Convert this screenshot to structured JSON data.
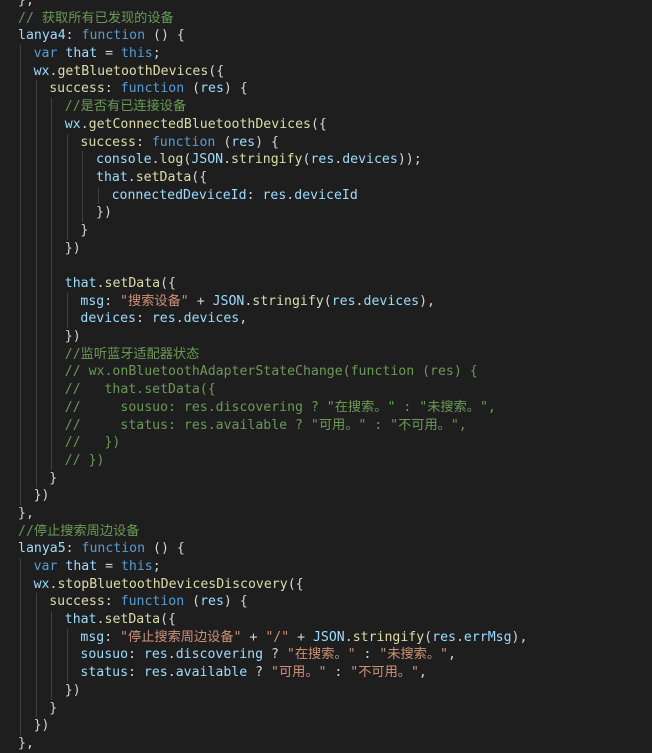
{
  "editor": {
    "lines": [
      {
        "indent": 0,
        "tokens": [
          {
            "t": "pn",
            "v": "},"
          }
        ]
      },
      {
        "indent": 0,
        "tokens": [
          {
            "t": "cm",
            "v": "// 获取所有已发现的设备"
          }
        ]
      },
      {
        "indent": 0,
        "tokens": [
          {
            "t": "var",
            "v": "lanya4"
          },
          {
            "t": "pn",
            "v": ": "
          },
          {
            "t": "kw",
            "v": "function"
          },
          {
            "t": "pn",
            "v": " () {"
          }
        ]
      },
      {
        "indent": 1,
        "tokens": [
          {
            "t": "kw",
            "v": "var"
          },
          {
            "t": "pn",
            "v": " "
          },
          {
            "t": "var",
            "v": "that"
          },
          {
            "t": "pn",
            "v": " = "
          },
          {
            "t": "kw",
            "v": "this"
          },
          {
            "t": "pn",
            "v": ";"
          }
        ]
      },
      {
        "indent": 1,
        "tokens": [
          {
            "t": "var",
            "v": "wx"
          },
          {
            "t": "pn",
            "v": "."
          },
          {
            "t": "fn",
            "v": "getBluetoothDevices"
          },
          {
            "t": "pn",
            "v": "({"
          }
        ]
      },
      {
        "indent": 2,
        "tokens": [
          {
            "t": "fn",
            "v": "success"
          },
          {
            "t": "pn",
            "v": ": "
          },
          {
            "t": "kw",
            "v": "function"
          },
          {
            "t": "pn",
            "v": " ("
          },
          {
            "t": "var",
            "v": "res"
          },
          {
            "t": "pn",
            "v": ") {"
          }
        ]
      },
      {
        "indent": 3,
        "tokens": [
          {
            "t": "cm",
            "v": "//是否有已连接设备"
          }
        ]
      },
      {
        "indent": 3,
        "tokens": [
          {
            "t": "var",
            "v": "wx"
          },
          {
            "t": "pn",
            "v": "."
          },
          {
            "t": "fn",
            "v": "getConnectedBluetoothDevices"
          },
          {
            "t": "pn",
            "v": "({"
          }
        ]
      },
      {
        "indent": 4,
        "tokens": [
          {
            "t": "fn",
            "v": "success"
          },
          {
            "t": "pn",
            "v": ": "
          },
          {
            "t": "kw",
            "v": "function"
          },
          {
            "t": "pn",
            "v": " ("
          },
          {
            "t": "var",
            "v": "res"
          },
          {
            "t": "pn",
            "v": ") {"
          }
        ]
      },
      {
        "indent": 5,
        "tokens": [
          {
            "t": "var",
            "v": "console"
          },
          {
            "t": "pn",
            "v": "."
          },
          {
            "t": "fn",
            "v": "log"
          },
          {
            "t": "pn",
            "v": "("
          },
          {
            "t": "var",
            "v": "JSON"
          },
          {
            "t": "pn",
            "v": "."
          },
          {
            "t": "fn",
            "v": "stringify"
          },
          {
            "t": "pn",
            "v": "("
          },
          {
            "t": "var",
            "v": "res"
          },
          {
            "t": "pn",
            "v": "."
          },
          {
            "t": "var",
            "v": "devices"
          },
          {
            "t": "pn",
            "v": "));"
          }
        ]
      },
      {
        "indent": 5,
        "tokens": [
          {
            "t": "var",
            "v": "that"
          },
          {
            "t": "pn",
            "v": "."
          },
          {
            "t": "fn",
            "v": "setData"
          },
          {
            "t": "pn",
            "v": "({"
          }
        ]
      },
      {
        "indent": 6,
        "tokens": [
          {
            "t": "var",
            "v": "connectedDeviceId"
          },
          {
            "t": "pn",
            "v": ": "
          },
          {
            "t": "var",
            "v": "res"
          },
          {
            "t": "pn",
            "v": "."
          },
          {
            "t": "var",
            "v": "deviceId"
          }
        ]
      },
      {
        "indent": 5,
        "tokens": [
          {
            "t": "pn",
            "v": "})"
          }
        ]
      },
      {
        "indent": 4,
        "tokens": [
          {
            "t": "pn",
            "v": "}"
          }
        ]
      },
      {
        "indent": 3,
        "tokens": [
          {
            "t": "pn",
            "v": "})"
          }
        ]
      },
      {
        "indent": 3,
        "tokens": []
      },
      {
        "indent": 3,
        "tokens": [
          {
            "t": "var",
            "v": "that"
          },
          {
            "t": "pn",
            "v": "."
          },
          {
            "t": "fn",
            "v": "setData"
          },
          {
            "t": "pn",
            "v": "({"
          }
        ]
      },
      {
        "indent": 4,
        "tokens": [
          {
            "t": "var",
            "v": "msg"
          },
          {
            "t": "pn",
            "v": ": "
          },
          {
            "t": "str",
            "v": "\"搜索设备\""
          },
          {
            "t": "pn",
            "v": " + "
          },
          {
            "t": "var",
            "v": "JSON"
          },
          {
            "t": "pn",
            "v": "."
          },
          {
            "t": "fn",
            "v": "stringify"
          },
          {
            "t": "pn",
            "v": "("
          },
          {
            "t": "var",
            "v": "res"
          },
          {
            "t": "pn",
            "v": "."
          },
          {
            "t": "var",
            "v": "devices"
          },
          {
            "t": "pn",
            "v": "),"
          }
        ]
      },
      {
        "indent": 4,
        "tokens": [
          {
            "t": "var",
            "v": "devices"
          },
          {
            "t": "pn",
            "v": ": "
          },
          {
            "t": "var",
            "v": "res"
          },
          {
            "t": "pn",
            "v": "."
          },
          {
            "t": "var",
            "v": "devices"
          },
          {
            "t": "pn",
            "v": ","
          }
        ]
      },
      {
        "indent": 3,
        "tokens": [
          {
            "t": "pn",
            "v": "})"
          }
        ]
      },
      {
        "indent": 3,
        "tokens": [
          {
            "t": "cm",
            "v": "//监听蓝牙适配器状态"
          }
        ]
      },
      {
        "indent": 3,
        "tokens": [
          {
            "t": "cm",
            "v": "// wx.onBluetoothAdapterStateChange(function (res) {"
          }
        ]
      },
      {
        "indent": 3,
        "tokens": [
          {
            "t": "cm",
            "v": "//   that.setData({"
          }
        ]
      },
      {
        "indent": 3,
        "tokens": [
          {
            "t": "cm",
            "v": "//     sousuo: res.discovering ? \"在搜索。\" : \"未搜索。\","
          }
        ]
      },
      {
        "indent": 3,
        "tokens": [
          {
            "t": "cm",
            "v": "//     status: res.available ? \"可用。\" : \"不可用。\","
          }
        ]
      },
      {
        "indent": 3,
        "tokens": [
          {
            "t": "cm",
            "v": "//   })"
          }
        ]
      },
      {
        "indent": 3,
        "tokens": [
          {
            "t": "cm",
            "v": "// })"
          }
        ]
      },
      {
        "indent": 2,
        "tokens": [
          {
            "t": "pn",
            "v": "}"
          }
        ]
      },
      {
        "indent": 1,
        "tokens": [
          {
            "t": "pn",
            "v": "})"
          }
        ]
      },
      {
        "indent": 0,
        "tokens": [
          {
            "t": "pn",
            "v": "},"
          }
        ]
      },
      {
        "indent": 0,
        "tokens": [
          {
            "t": "cm",
            "v": "//停止搜索周边设备"
          }
        ]
      },
      {
        "indent": 0,
        "tokens": [
          {
            "t": "var",
            "v": "lanya5"
          },
          {
            "t": "pn",
            "v": ": "
          },
          {
            "t": "kw",
            "v": "function"
          },
          {
            "t": "pn",
            "v": " () {"
          }
        ]
      },
      {
        "indent": 1,
        "tokens": [
          {
            "t": "kw",
            "v": "var"
          },
          {
            "t": "pn",
            "v": " "
          },
          {
            "t": "var",
            "v": "that"
          },
          {
            "t": "pn",
            "v": " = "
          },
          {
            "t": "kw",
            "v": "this"
          },
          {
            "t": "pn",
            "v": ";"
          }
        ]
      },
      {
        "indent": 1,
        "tokens": [
          {
            "t": "var",
            "v": "wx"
          },
          {
            "t": "pn",
            "v": "."
          },
          {
            "t": "fn",
            "v": "stopBluetoothDevicesDiscovery"
          },
          {
            "t": "pn",
            "v": "({"
          }
        ]
      },
      {
        "indent": 2,
        "tokens": [
          {
            "t": "fn",
            "v": "success"
          },
          {
            "t": "pn",
            "v": ": "
          },
          {
            "t": "kw",
            "v": "function"
          },
          {
            "t": "pn",
            "v": " ("
          },
          {
            "t": "var",
            "v": "res"
          },
          {
            "t": "pn",
            "v": ") {"
          }
        ]
      },
      {
        "indent": 3,
        "tokens": [
          {
            "t": "var",
            "v": "that"
          },
          {
            "t": "pn",
            "v": "."
          },
          {
            "t": "fn",
            "v": "setData"
          },
          {
            "t": "pn",
            "v": "({"
          }
        ]
      },
      {
        "indent": 4,
        "tokens": [
          {
            "t": "var",
            "v": "msg"
          },
          {
            "t": "pn",
            "v": ": "
          },
          {
            "t": "str",
            "v": "\"停止搜索周边设备\""
          },
          {
            "t": "pn",
            "v": " + "
          },
          {
            "t": "str",
            "v": "\"/\""
          },
          {
            "t": "pn",
            "v": " + "
          },
          {
            "t": "var",
            "v": "JSON"
          },
          {
            "t": "pn",
            "v": "."
          },
          {
            "t": "fn",
            "v": "stringify"
          },
          {
            "t": "pn",
            "v": "("
          },
          {
            "t": "var",
            "v": "res"
          },
          {
            "t": "pn",
            "v": "."
          },
          {
            "t": "var",
            "v": "errMsg"
          },
          {
            "t": "pn",
            "v": "),"
          }
        ]
      },
      {
        "indent": 4,
        "tokens": [
          {
            "t": "var",
            "v": "sousuo"
          },
          {
            "t": "pn",
            "v": ": "
          },
          {
            "t": "var",
            "v": "res"
          },
          {
            "t": "pn",
            "v": "."
          },
          {
            "t": "var",
            "v": "discovering"
          },
          {
            "t": "pn",
            "v": " ? "
          },
          {
            "t": "str",
            "v": "\"在搜索。\""
          },
          {
            "t": "pn",
            "v": " : "
          },
          {
            "t": "str",
            "v": "\"未搜索。\""
          },
          {
            "t": "pn",
            "v": ","
          }
        ]
      },
      {
        "indent": 4,
        "tokens": [
          {
            "t": "var",
            "v": "status"
          },
          {
            "t": "pn",
            "v": ": "
          },
          {
            "t": "var",
            "v": "res"
          },
          {
            "t": "pn",
            "v": "."
          },
          {
            "t": "var",
            "v": "available"
          },
          {
            "t": "pn",
            "v": " ? "
          },
          {
            "t": "str",
            "v": "\"可用。\""
          },
          {
            "t": "pn",
            "v": " : "
          },
          {
            "t": "str",
            "v": "\"不可用。\""
          },
          {
            "t": "pn",
            "v": ","
          }
        ]
      },
      {
        "indent": 3,
        "tokens": [
          {
            "t": "pn",
            "v": "})"
          }
        ]
      },
      {
        "indent": 2,
        "tokens": [
          {
            "t": "pn",
            "v": "}"
          }
        ]
      },
      {
        "indent": 1,
        "tokens": [
          {
            "t": "pn",
            "v": "})"
          }
        ]
      },
      {
        "indent": 0,
        "tokens": [
          {
            "t": "pn",
            "v": "},"
          }
        ]
      }
    ]
  }
}
